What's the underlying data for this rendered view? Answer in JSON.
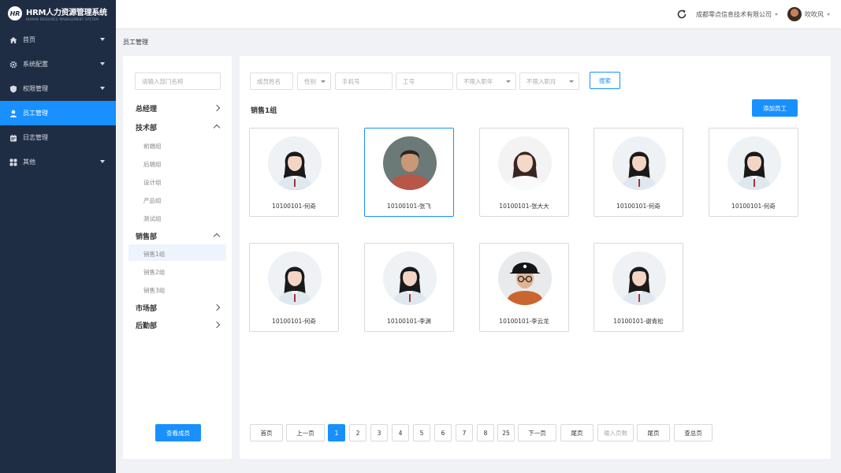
{
  "brand": {
    "logo_text": "HR",
    "title": "HRM人力资源管理系统",
    "subtitle": "HUMAN RESOURCE MANAGEMENT SYSTEM"
  },
  "sidebar": {
    "items": [
      {
        "label": "首页",
        "icon": "home-icon",
        "has_arrow": true,
        "active": false
      },
      {
        "label": "系统配置",
        "icon": "gear-icon",
        "has_arrow": true,
        "active": false
      },
      {
        "label": "权限管理",
        "icon": "shield-icon",
        "has_arrow": true,
        "active": false
      },
      {
        "label": "员工管理",
        "icon": "user-icon",
        "has_arrow": false,
        "active": true
      },
      {
        "label": "日志管理",
        "icon": "calendar-icon",
        "has_arrow": false,
        "active": false
      },
      {
        "label": "其他",
        "icon": "grid-icon",
        "has_arrow": true,
        "active": false
      }
    ]
  },
  "header": {
    "company": "成都零点信息技术有限公司",
    "user_name": "吹吹风"
  },
  "breadcrumb": "员工管理",
  "dept_panel": {
    "search_placeholder": "请输入部门名称",
    "tree": [
      {
        "label": "总经理",
        "expanded": false
      },
      {
        "label": "技术部",
        "expanded": true,
        "children": [
          "前端组",
          "后端组",
          "设计组",
          "产品组",
          "测试组"
        ]
      },
      {
        "label": "销售部",
        "expanded": true,
        "children": [
          "销售1组",
          "销售2组",
          "销售3组"
        ],
        "active_child": "销售1组"
      },
      {
        "label": "市场部",
        "expanded": false
      },
      {
        "label": "后勤部",
        "expanded": false
      }
    ],
    "view_button": "查看成员"
  },
  "filters": {
    "name_placeholder": "成员姓名",
    "gender_placeholder": "性别",
    "phone_placeholder": "手机号",
    "id_placeholder": "工号",
    "year_placeholder": "不限入职年",
    "month_placeholder": "不限入职月",
    "search_button": "搜索"
  },
  "group": {
    "title": "销售1组",
    "add_button": "添加员工"
  },
  "employees": [
    {
      "label": "10100101-何奇",
      "avatar": "woman-avatar",
      "selected": false
    },
    {
      "label": "10100101-张飞",
      "avatar": "man-avatar",
      "selected": true
    },
    {
      "label": "10100101-张大大",
      "avatar": "woman-avatar-2",
      "selected": false
    },
    {
      "label": "10100101-何奇",
      "avatar": "woman-avatar",
      "selected": false
    },
    {
      "label": "10100101-何奇",
      "avatar": "woman-avatar",
      "selected": false
    },
    {
      "label": "10100101-何奇",
      "avatar": "woman-avatar",
      "selected": false
    },
    {
      "label": "10100101-李渊",
      "avatar": "woman-avatar",
      "selected": false
    },
    {
      "label": "10100101-李云龙",
      "avatar": "man-hat-avatar",
      "selected": false
    },
    {
      "label": "10100101-谢青松",
      "avatar": "woman-avatar",
      "selected": false
    }
  ],
  "pagination": {
    "first": "首页",
    "prev": "上一页",
    "pages": [
      "1",
      "2",
      "3",
      "4",
      "5",
      "6",
      "7",
      "8",
      "25"
    ],
    "current": "1",
    "next": "下一页",
    "last": "尾页",
    "jump_placeholder": "输入页数",
    "jump_end": "尾页",
    "total": "查总页"
  },
  "colors": {
    "sidebar_bg": "#1f2d44",
    "accent": "#1890ff",
    "page_bg": "#f0f2f5"
  }
}
